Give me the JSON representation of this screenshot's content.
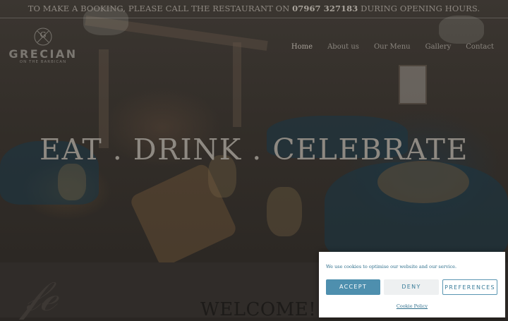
{
  "topbar": {
    "text_before": "TO MAKE A BOOKING, PLEASE CALL THE RESTAURANT ON ",
    "phone": "07967 327183",
    "text_after": " DURING OPENING HOURS."
  },
  "logo": {
    "monogram": "G",
    "name": "GRECIAN",
    "subtitle": "ON THE BARBICAN"
  },
  "nav": {
    "items": [
      {
        "label": "Home",
        "active": true
      },
      {
        "label": "About us"
      },
      {
        "label": "Our Menu"
      },
      {
        "label": "Gallery"
      },
      {
        "label": "Contact"
      }
    ]
  },
  "hero": {
    "title": "EAT . DRINK . CELEBRATE"
  },
  "welcome": {
    "title": "WELCOME!"
  },
  "cookie": {
    "message": "We use cookies to optimise our website and our service.",
    "accept_label": "ACCEPT",
    "deny_label": "DENY",
    "preferences_label": "PREFERENCES",
    "policy_label": "Cookie Policy",
    "accent_color": "#4e8fae"
  }
}
